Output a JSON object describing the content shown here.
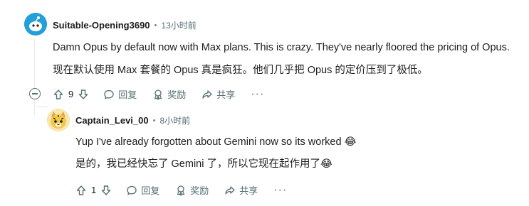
{
  "comments": [
    {
      "username": "Suitable-Opening3690",
      "separator": "•",
      "time": "13小时前",
      "line1": "Damn Opus by default now with Max plans. This is crazy. They've nearly floored the pricing of Opus.",
      "line2": "现在默认使用 Max 套餐的 Opus 真是疯狂。他们几乎把 Opus 的定价压到了极低。",
      "votes": "9",
      "reply_label": "回复",
      "award_label": "奖励",
      "share_label": "共享",
      "more_label": "···"
    },
    {
      "username": "Captain_Levi_00",
      "separator": "•",
      "time": "8小时前",
      "line1": "Yup I've already forgotten about Gemini now so its worked 😂",
      "line2": "是的，我已经快忘了 Gemini 了，所以它现在起作用了😂",
      "votes": "1",
      "reply_label": "回复",
      "award_label": "奖励",
      "share_label": "共享",
      "more_label": "···"
    }
  ],
  "colors": {
    "avatar1_bg": "#24a0d8",
    "avatar2_bg": "#f2c84b",
    "thread_line": "#e5ebee"
  }
}
